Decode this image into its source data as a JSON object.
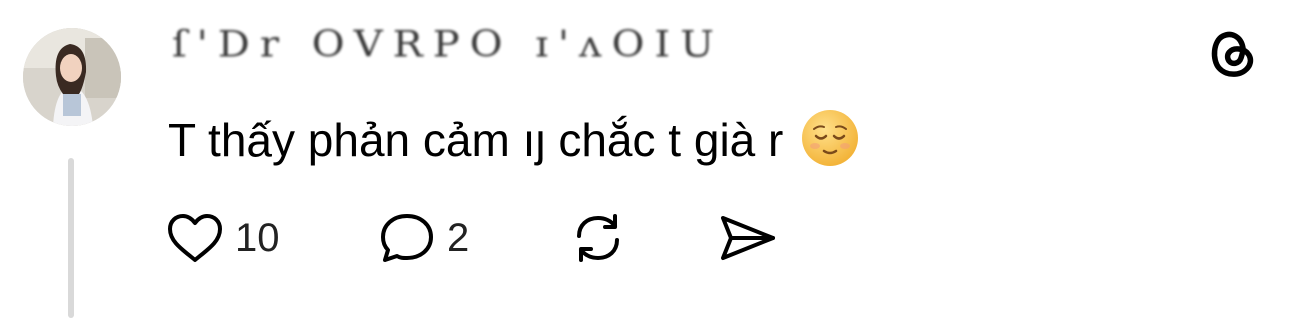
{
  "post": {
    "username": "ſ'Dr OVRPO ɪ'ʌOIU",
    "comment_text": "T thấy phản cảm ıȷ chắc t già r",
    "emoji": "relieved-face-emoji",
    "actions": {
      "like_count": "10",
      "reply_count": "2"
    }
  },
  "icons": {
    "logo": "threads-icon",
    "like": "heart-icon",
    "reply": "speech-bubble-icon",
    "repost": "repost-icon",
    "share": "send-icon"
  },
  "colors": {
    "background": "#ffffff",
    "text": "#000000",
    "thread_line": "#d9d9d9",
    "emoji_face": "#f7c94a"
  }
}
